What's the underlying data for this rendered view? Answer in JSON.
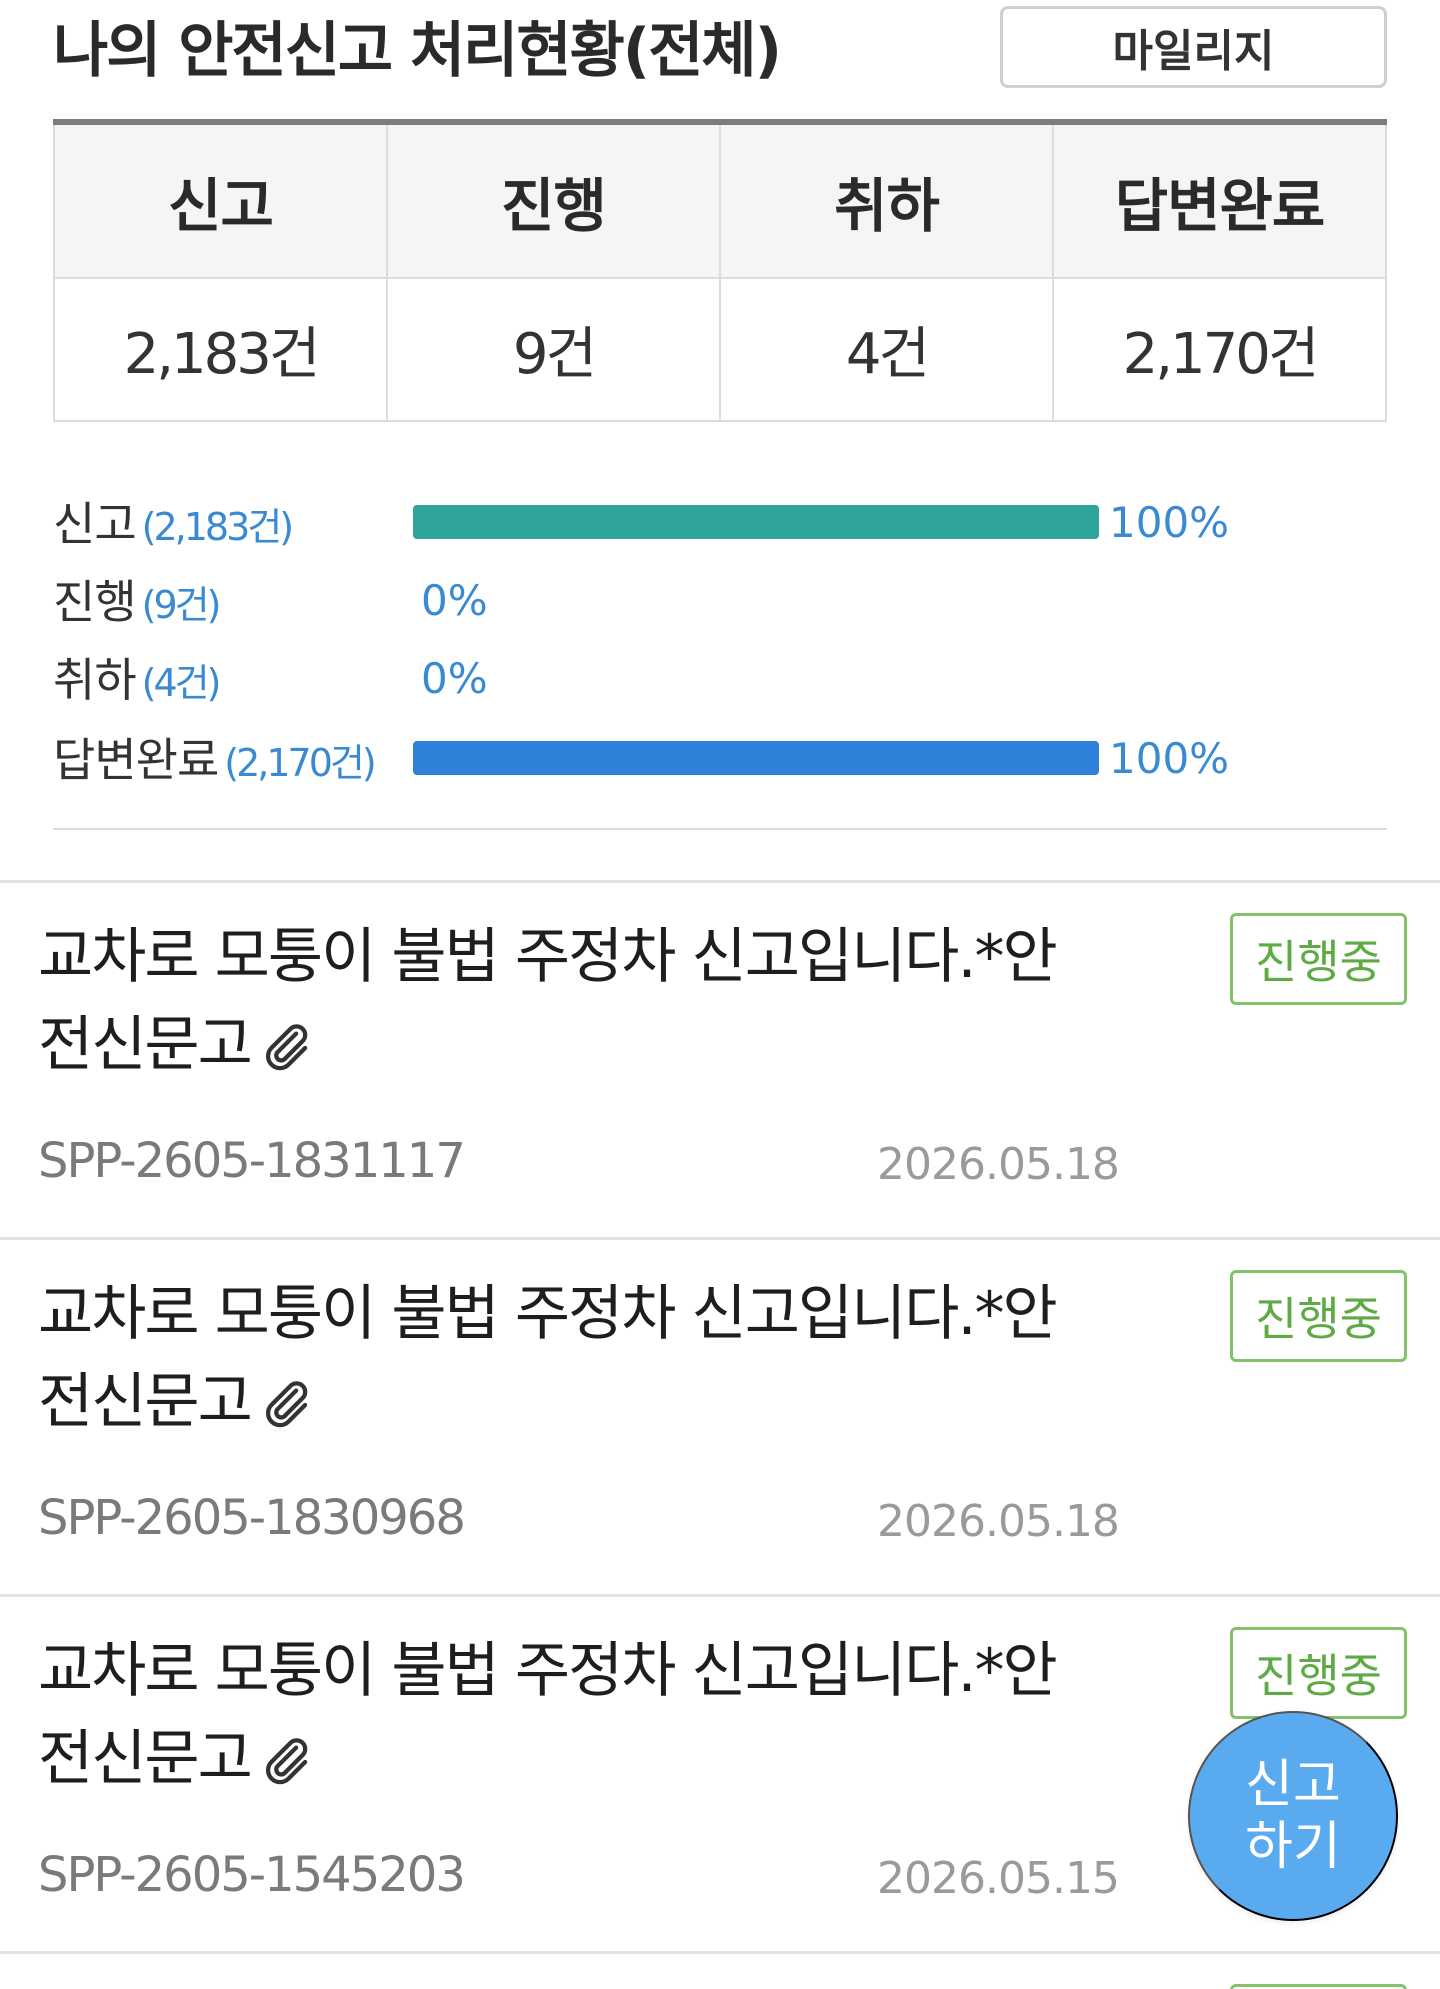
{
  "header": {
    "title": "나의 안전신고 처리현황(전체)",
    "mileage_label": "마일리지"
  },
  "summary": {
    "headers": [
      "신고",
      "진행",
      "취하",
      "답변완료"
    ],
    "values": [
      "2,183건",
      "9건",
      "4건",
      "2,170건"
    ]
  },
  "stats": [
    {
      "label": "신고",
      "count": "(2,183건)",
      "percent": "100%",
      "fraction": 1.0,
      "color": "#2fa59a"
    },
    {
      "label": "진행",
      "count": "(9건)",
      "percent": "0%",
      "fraction": 0.0,
      "color": "#2fa59a"
    },
    {
      "label": "취하",
      "count": "(4건)",
      "percent": "0%",
      "fraction": 0.0,
      "color": "#2fa59a"
    },
    {
      "label": "답변완료",
      "count": "(2,170건)",
      "percent": "100%",
      "fraction": 1.0,
      "color": "#2f80d8"
    }
  ],
  "reports": [
    {
      "title": "교차로 모퉁이 불법 주정차 신고입니다.*안전신문고",
      "status": "진행중",
      "code": "SPP-2605-1831117",
      "date": "2026.05.18",
      "attachment_icon": "paperclip-icon"
    },
    {
      "title": "교차로 모퉁이 불법 주정차 신고입니다.*안전신문고",
      "status": "진행중",
      "code": "SPP-2605-1830968",
      "date": "2026.05.18",
      "attachment_icon": "paperclip-icon"
    },
    {
      "title": "교차로 모퉁이 불법 주정차 신고입니다.*안전신문고",
      "status": "진행중",
      "code": "SPP-2605-1545203",
      "date": "2026.05.15",
      "attachment_icon": "paperclip-icon"
    }
  ],
  "fab": {
    "label": "신고\n하기"
  },
  "colors": {
    "accent_green": "#82c36a",
    "link_blue": "#3a8ad2",
    "fab_blue": "#5aaaf0"
  }
}
